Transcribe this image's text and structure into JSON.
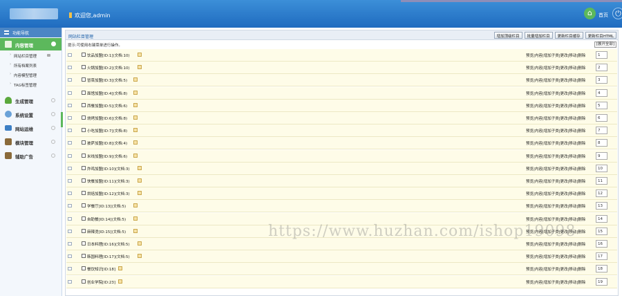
{
  "header": {
    "welcome_text": "欢迎您,admin",
    "home_label": "首页",
    "home_icon": "home-icon",
    "power_icon": "power-icon"
  },
  "sidebar": {
    "nav_title": "功能导航",
    "active_category": "内容管理",
    "sub_items": [
      "网站栏目管理",
      "所有档案列表",
      "内容模型管理",
      "TAG标签管理"
    ],
    "categories": [
      {
        "label": "生成管理",
        "icon": "tree-icon"
      },
      {
        "label": "系统设置",
        "icon": "gear-icon"
      },
      {
        "label": "网站运维",
        "icon": "monitor-icon"
      },
      {
        "label": "模块管理",
        "icon": "book-icon"
      },
      {
        "label": "辅助广告",
        "icon": "book-icon"
      }
    ]
  },
  "main": {
    "title": "网站栏目管理",
    "buttons": [
      "增加顶级栏目",
      "批量增加栏目",
      "更新栏目缓存",
      "更新栏目HTML"
    ],
    "hint": "提示:可使用右键菜单进行操作。",
    "expand_all": "[展开全部]",
    "ops_text": "预览|内容|增加子类|更改|移动|删除",
    "rows": [
      {
        "name": "饮品加盟[ID:1](文档:10)",
        "sort": "1"
      },
      {
        "name": "火锅加盟[ID:2](文档:10)",
        "sort": "2"
      },
      {
        "name": "冒菜加盟[ID:3](文档:5)",
        "sort": "3"
      },
      {
        "name": "面馆加盟[ID:4](文档:8)",
        "sort": "4"
      },
      {
        "name": "西餐加盟[ID:5](文档:6)",
        "sort": "5"
      },
      {
        "name": "烧烤加盟[ID:6](文档:8)",
        "sort": "6"
      },
      {
        "name": "小吃加盟[ID:7](文档:8)",
        "sort": "7"
      },
      {
        "name": "披萨加盟[ID:8](文档:4)",
        "sort": "8"
      },
      {
        "name": "米线加盟[ID:9](文档:6)",
        "sort": "9"
      },
      {
        "name": "炸鸡加盟[ID:10](文档:3)",
        "sort": "10"
      },
      {
        "name": "快餐加盟[ID:11](文档:3)",
        "sort": "11"
      },
      {
        "name": "烘焙加盟[ID:12](文档:3)",
        "sort": "12"
      },
      {
        "name": "学餐厅[ID:13](文档:5)",
        "sort": "13"
      },
      {
        "name": "自助餐[ID:14](文档:5)",
        "sort": "14"
      },
      {
        "name": "麻辣烫[ID:15](文档:5)",
        "sort": "15"
      },
      {
        "name": "日本料理[ID:16](文档:5)",
        "sort": "16"
      },
      {
        "name": "韩国料理[ID:17](文档:5)",
        "sort": "17"
      },
      {
        "name": "餐饮知识[ID:18]",
        "sort": "18"
      },
      {
        "name": "创业学院[ID:23]",
        "sort": "19"
      }
    ]
  },
  "watermark": "https://www.huzhan.com/ishop19098"
}
